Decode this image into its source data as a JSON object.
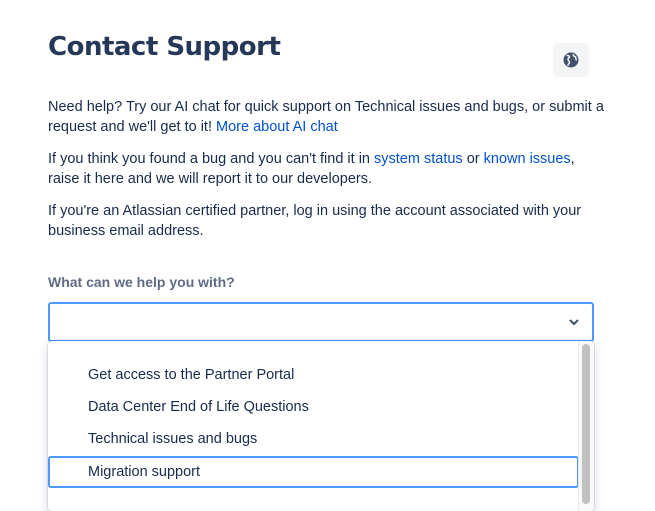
{
  "header": {
    "title": "Contact Support",
    "language_icon": "globe-icon"
  },
  "intro": {
    "p1_text": "Need help? Try our AI chat for quick support on Technical issues and bugs, or submit a request and we'll get to it! ",
    "p1_link": "More about AI chat",
    "p2_pre": "If you think you found a bug and you can't find it in ",
    "p2_link1": "system status",
    "p2_mid": " or ",
    "p2_link2": "known issues",
    "p2_post": ", raise it here and we will report it to our developers.",
    "p3_text": "If you're an Atlassian certified partner, log in using the account associated with your business email address."
  },
  "form": {
    "label": "What can we help you with?",
    "selected_value": "",
    "options": [
      "Get access to the Partner Portal",
      "Data Center End of Life Questions",
      "Technical issues and bugs",
      "Migration support"
    ]
  },
  "colors": {
    "link": "#0052cc",
    "focus": "#4c9aff",
    "title": "#253858"
  }
}
